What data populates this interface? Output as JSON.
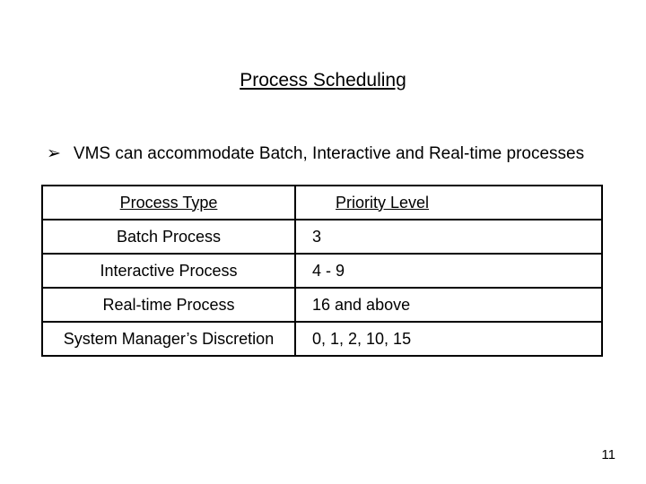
{
  "title": "Process Scheduling",
  "bullet": {
    "glyph": "➢",
    "text": "VMS can accommodate Batch, Interactive and Real-time processes"
  },
  "table": {
    "headers": {
      "type": "Process Type",
      "priority": "Priority Level"
    },
    "rows": [
      {
        "type": "Batch Process",
        "priority": "3"
      },
      {
        "type": "Interactive Process",
        "priority": "4 - 9"
      },
      {
        "type": "Real-time Process",
        "priority": "16 and above"
      },
      {
        "type": "System Manager’s Discretion",
        "priority": "0, 1, 2, 10, 15"
      }
    ]
  },
  "page_number": "11",
  "chart_data": {
    "type": "table",
    "columns": [
      "Process Type",
      "Priority Level"
    ],
    "rows": [
      [
        "Batch Process",
        "3"
      ],
      [
        "Interactive Process",
        "4 - 9"
      ],
      [
        "Real-time Process",
        "16 and above"
      ],
      [
        "System Manager’s Discretion",
        "0, 1, 2, 10, 15"
      ]
    ]
  }
}
